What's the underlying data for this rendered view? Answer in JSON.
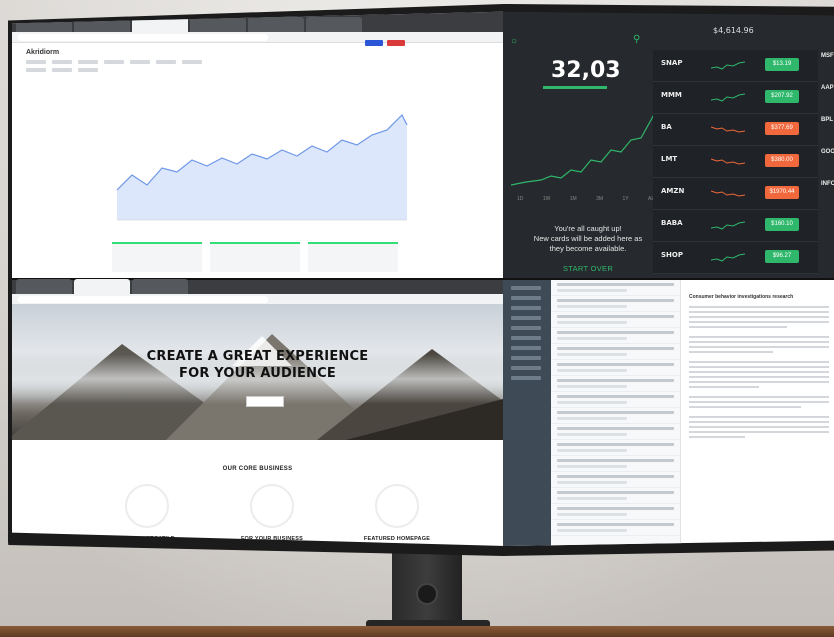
{
  "photo": {
    "description_subject": "curved monitor with four quadrants"
  },
  "screen_top_left": {
    "page_heading": "Akridiorm"
  },
  "screen_top_right": {
    "balance": "$4,614.96",
    "price": "32,03",
    "range_labels": [
      "1D",
      "1W",
      "1M",
      "3M",
      "1Y",
      "ALL"
    ],
    "caught_up_line1": "You're all caught up!",
    "caught_up_line2": "New cards will be added here as",
    "caught_up_line3": "they become available.",
    "start_over": "START OVER",
    "stocks": [
      {
        "ticker": "SNAP",
        "price": "$13.19",
        "trend": "up"
      },
      {
        "ticker": "MMM",
        "price": "$207.92",
        "trend": "up"
      },
      {
        "ticker": "BA",
        "price": "$377.69",
        "trend": "down"
      },
      {
        "ticker": "LMT",
        "price": "$380.00",
        "trend": "down"
      },
      {
        "ticker": "AMZN",
        "price": "$1970.44",
        "trend": "down"
      },
      {
        "ticker": "BABA",
        "price": "$160.10",
        "trend": "up"
      },
      {
        "ticker": "SHOP",
        "price": "$96.27",
        "trend": "up"
      }
    ],
    "side_tickers": [
      "MSFT",
      "AAPL",
      "BPL",
      "GOO",
      "INFO"
    ],
    "colors": {
      "green": "#2fb86b",
      "orange": "#f0683c"
    }
  },
  "screen_bottom_left": {
    "hero_line1": "CREATE A GREAT EXPERIENCE",
    "hero_line2": "FOR YOUR AUDIENCE",
    "section_title": "OUR CORE BUSINESS",
    "features": [
      "HIGHLY VERSATILE",
      "FOR YOUR BUSINESS",
      "FEATURED HOMEPAGE"
    ]
  },
  "screen_bottom_right": {
    "subject": "Consumer behavior investigations research"
  }
}
